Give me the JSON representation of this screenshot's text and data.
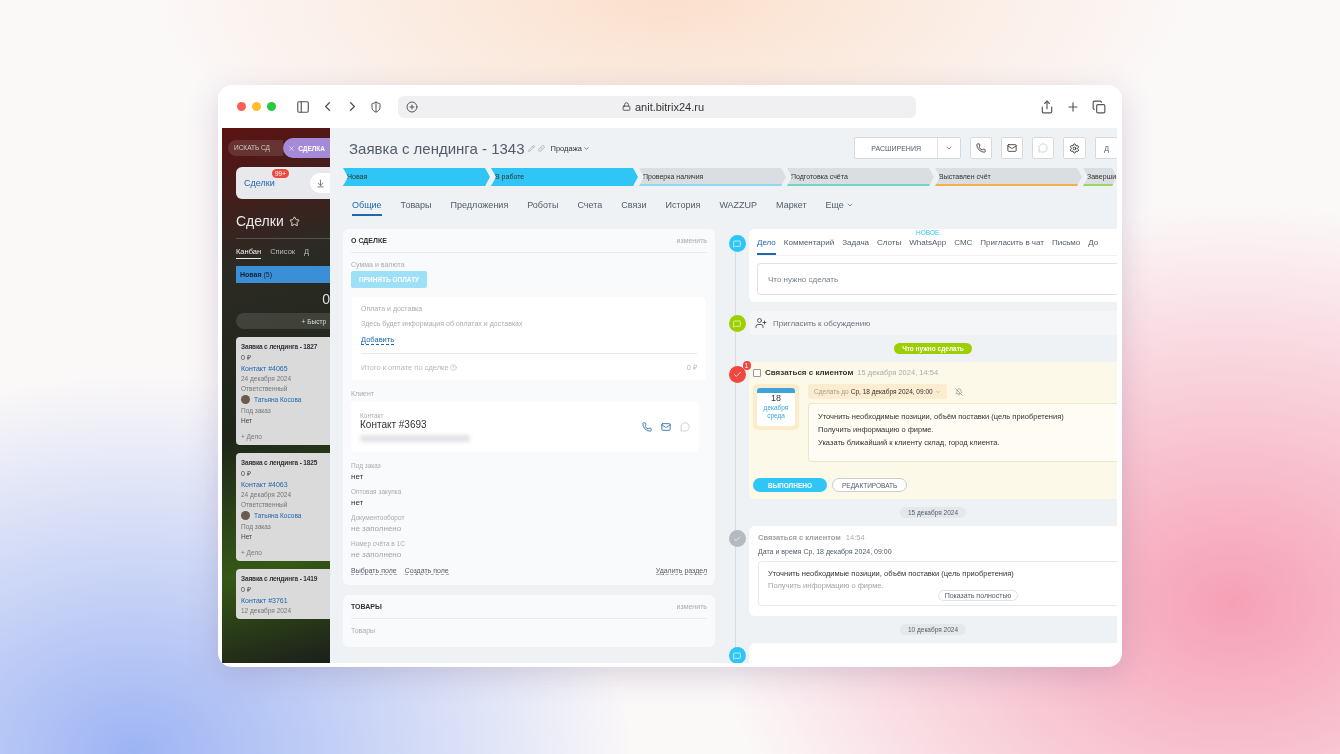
{
  "browser": {
    "url": "anit.bitrix24.ru"
  },
  "sidebar": {
    "search_placeholder": "ИСКАТЬ СД",
    "chip": "СДЕЛКА",
    "section_tab": {
      "label": "Сделки",
      "badge": "99+"
    },
    "title": "Сделки",
    "views": [
      {
        "label": "Канбан",
        "selected": true
      },
      {
        "label": "Список",
        "selected": false
      },
      {
        "label": "Д",
        "selected": false
      }
    ],
    "column": {
      "name": "Новая",
      "count": "(5)",
      "total": "0",
      "quick_add": "+ Быстр"
    },
    "cards": [
      {
        "title": "Заявка с лендинга - 1827",
        "amount": "0 ₽",
        "contact": "Контакт #4065",
        "date": "24 декабря 2024",
        "responsible_label": "Ответственный",
        "responsible": "Татьяна Косова",
        "field_label": "Под заказ",
        "field_value": "Нет",
        "add_activity": "+ Дело"
      },
      {
        "title": "Заявка с лендинга - 1825",
        "amount": "0 ₽",
        "contact": "Контакт #4063",
        "date": "24 декабря 2024",
        "responsible_label": "Ответственный",
        "responsible": "Татьяна Косова",
        "field_label": "Под заказ",
        "field_value": "Нет",
        "add_activity": "+ Дело"
      },
      {
        "title": "Заявка с лендинга - 1419",
        "amount": "0 ₽",
        "contact": "Контакт #3761",
        "date": "12 декабря 2024"
      }
    ]
  },
  "deal": {
    "title": "Заявка с лендинга - 1343",
    "pipeline": "Продажа",
    "extensions_button": "РАСШИРЕНИЯ",
    "cut_button": "Д"
  },
  "stages": [
    {
      "label": "Новая",
      "active": true,
      "color": "#2fc6f6"
    },
    {
      "label": "В работе",
      "active": true,
      "color": "#2fc6f6"
    },
    {
      "label": "Проверка наличия",
      "active": false,
      "color": "#8fd8f0"
    },
    {
      "label": "Подготовка счёта",
      "active": false,
      "color": "#6fd6c6"
    },
    {
      "label": "Выставлен счёт",
      "active": false,
      "color": "#f2b04a"
    },
    {
      "label": "Заверши",
      "active": false,
      "color": "#9ed36a"
    }
  ],
  "tabs": [
    {
      "label": "Общие",
      "selected": true
    },
    {
      "label": "Товары",
      "selected": false
    },
    {
      "label": "Предложения",
      "selected": false
    },
    {
      "label": "Роботы",
      "selected": false
    },
    {
      "label": "Счета",
      "selected": false
    },
    {
      "label": "Связи",
      "selected": false
    },
    {
      "label": "История",
      "selected": false
    },
    {
      "label": "WAZZUP",
      "selected": false
    },
    {
      "label": "Маркет",
      "selected": false
    }
  ],
  "more_tab": "Еще",
  "about": {
    "heading": "О СДЕЛКЕ",
    "edit": "изменить",
    "amount_label": "Сумма и валюта",
    "pay_button": "ПРИНЯТЬ ОПЛАТУ",
    "payment": {
      "title": "Оплата и доставка",
      "hint": "Здесь будет информация об оплатах и доставках",
      "add": "Добавить",
      "total_label": "Итого к оплате по сделке",
      "total": "0 ₽"
    },
    "client_label": "Клиент",
    "contact": {
      "label": "Контакт",
      "name": "Контакт #3693"
    },
    "fields": [
      {
        "label": "Под заказ",
        "value": "нет",
        "filled": true
      },
      {
        "label": "Оптовая закупка",
        "value": "нет",
        "filled": true
      },
      {
        "label": "Документооборот",
        "value": "не заполнено",
        "filled": false
      },
      {
        "label": "Номер счёта в 1С",
        "value": "не заполнено",
        "filled": false
      }
    ],
    "actions": [
      "Выбрать поле",
      "Создать поле"
    ],
    "delete": "Удалить раздел"
  },
  "products": {
    "heading": "ТОВАРЫ",
    "edit": "изменить",
    "label": "Товары"
  },
  "composer": {
    "tabs": [
      {
        "label": "Дело",
        "selected": true
      },
      {
        "label": "Комментарий",
        "selected": false
      },
      {
        "label": "Задача",
        "selected": false
      },
      {
        "label": "Слоты",
        "selected": false
      },
      {
        "label": "WhatsApp",
        "selected": false,
        "badge": "НОВОЕ"
      },
      {
        "label": "СМС",
        "selected": false
      },
      {
        "label": "Пригласить в чат",
        "selected": false
      },
      {
        "label": "Письмо",
        "selected": false
      },
      {
        "label": "До",
        "selected": false
      }
    ],
    "placeholder": "Что нужно сделать"
  },
  "invite": "Пригласить к обсуждению",
  "todo_pill": "Что нужно сделать",
  "activity": {
    "checked": false,
    "title": "Связаться с клиентом",
    "created": "15 декабря 2024, 14:54",
    "counter": "1",
    "calendar": {
      "day": "18",
      "month": "декабря",
      "weekday": "среда"
    },
    "deadline_label": "Сделать до",
    "deadline": "Ср, 18 декабря 2024, 09:00",
    "lines": [
      "Уточнить необходимые позиции, объём поставки (цель приобретения)",
      "Получить информацию о фирме.",
      "Указать ближайший к клиенту склад, город клиента."
    ],
    "done_button": "ВЫПОЛНЕНО",
    "edit_button": "РЕДАКТИРОВАТЬ"
  },
  "history": [
    {
      "kind": "date",
      "label": "15 декабря 2024"
    },
    {
      "kind": "activity",
      "title": "Связаться с клиентом",
      "time": "14:54",
      "when_label": "Дата и время",
      "when": "Ср, 18 декабря 2024, 09:00",
      "lines": [
        "Уточнить необходимые позиции, объём поставки (цель приобретения)",
        "Получить информацию о фирме."
      ],
      "more": "Показать полностью"
    },
    {
      "kind": "date",
      "label": "10 декабря 2024"
    },
    {
      "kind": "stub"
    }
  ]
}
